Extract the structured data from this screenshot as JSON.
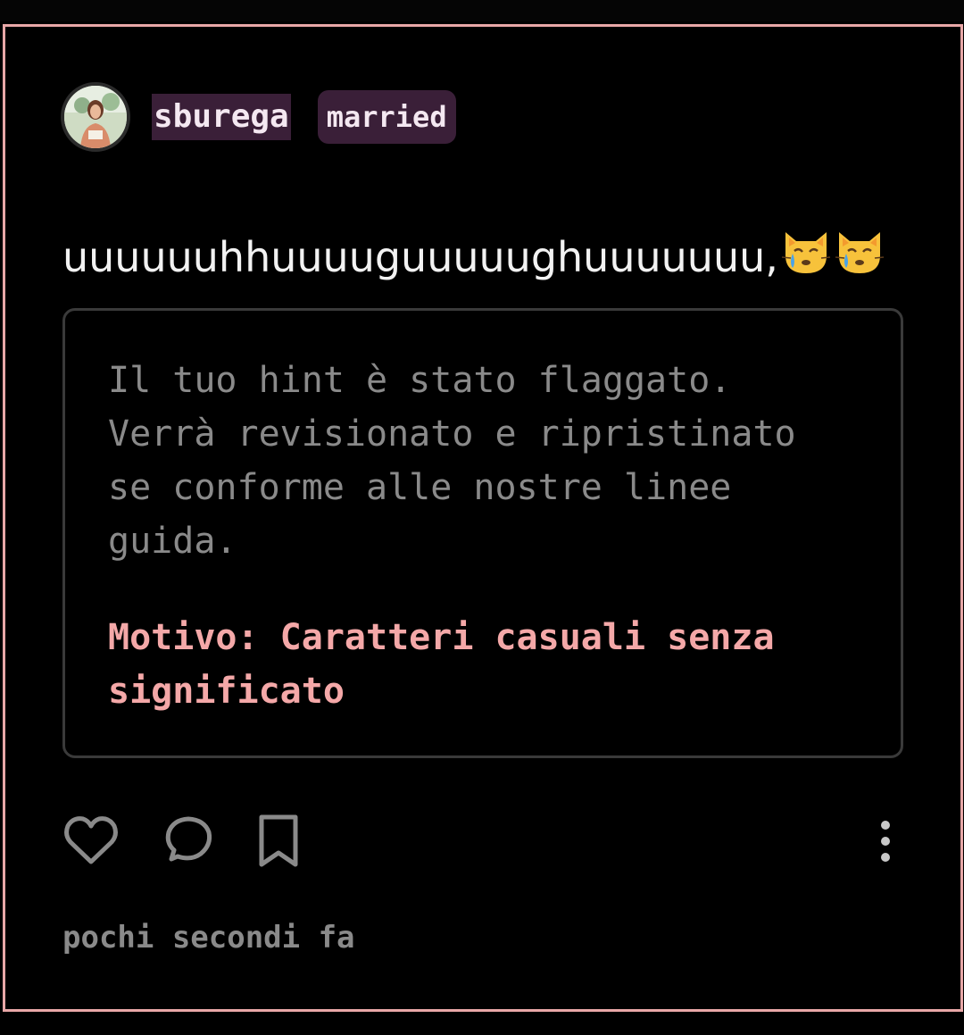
{
  "post": {
    "username": "sburega",
    "badge": "married",
    "text": "uuuuuuhhuuuuguuuuughuuuuuuu,",
    "emojis": [
      "crying-cat-face",
      "crying-cat-face"
    ],
    "timestamp": "pochi secondi fa"
  },
  "flag_notice": {
    "message": "Il tuo hint è stato flaggato. Verrà revisionato e ripristinato se conforme alle nostre linee guida.",
    "reason": "Motivo: Caratteri casuali senza significato"
  },
  "actions": {
    "like_icon": "heart-icon",
    "comment_icon": "speech-bubble-icon",
    "save_icon": "bookmark-icon",
    "more_icon": "more-vertical-icon"
  },
  "colors": {
    "background": "#000000",
    "card_border": "#e8a7a7",
    "username_bg": "#3a1f38",
    "reason_text": "#f4a8a8",
    "muted_text": "#8a8a8a"
  }
}
